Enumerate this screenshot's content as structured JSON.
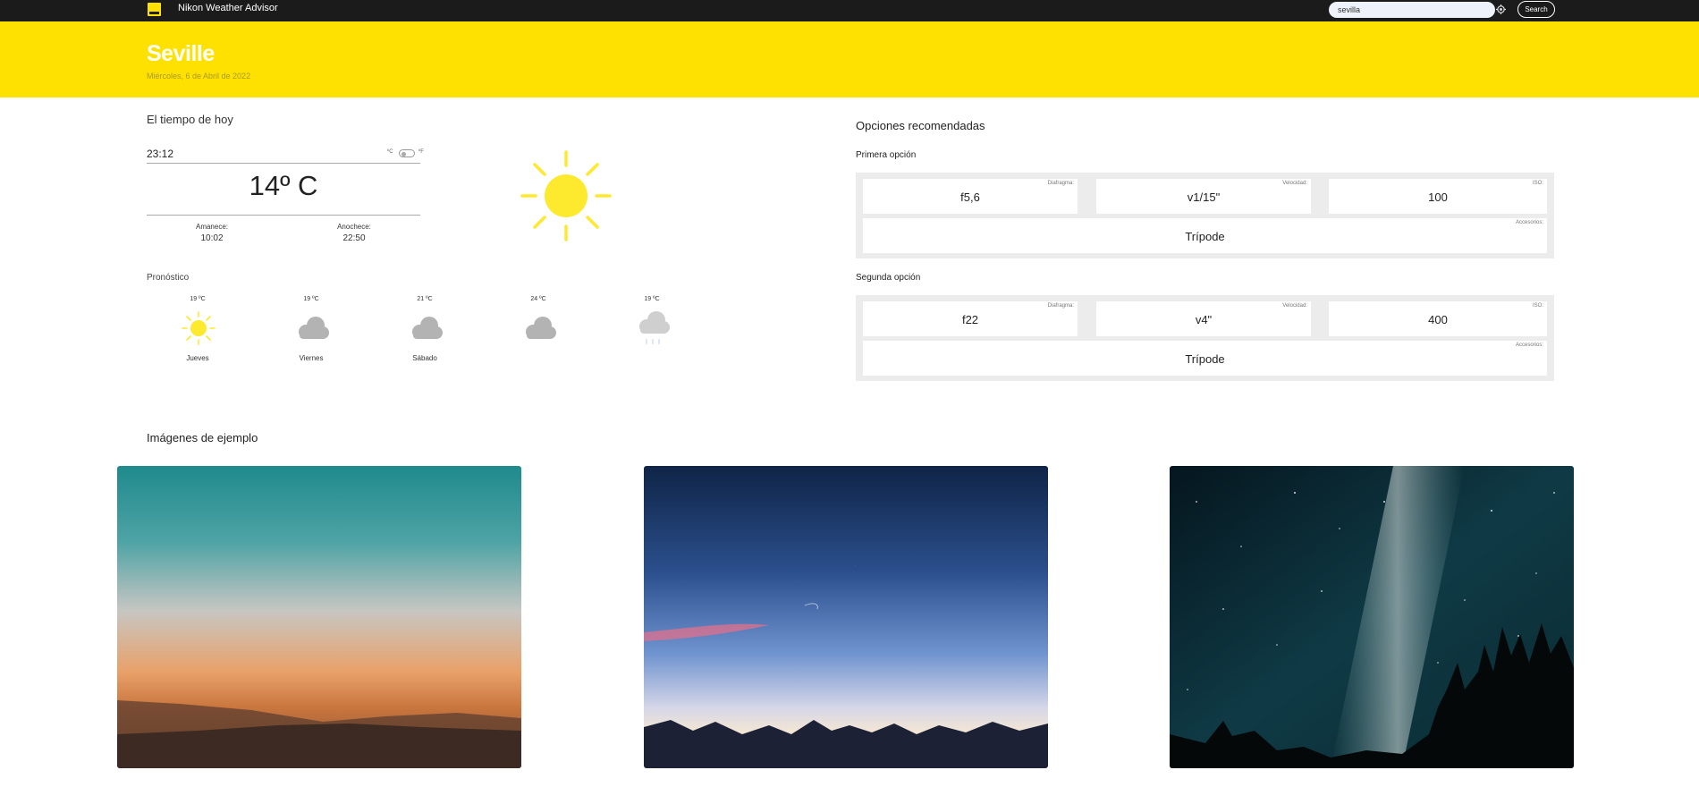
{
  "app": {
    "brand": "Nikon Weather Advisor",
    "logo_icon": "nikon-logo-icon"
  },
  "search": {
    "value": "sevilla",
    "button_label": "Search",
    "locate_icon": "crosshair-icon"
  },
  "hero": {
    "city": "Seville",
    "date": "Miércoles, 6 de Abril de 2022"
  },
  "today": {
    "heading": "El tiempo de hoy",
    "time": "23:12",
    "unit_c": "ºC",
    "unit_f": "ºF",
    "temperature": "14º C",
    "sunrise_label": "Amanece:",
    "sunrise": "10:02",
    "sunset_label": "Anochece:",
    "sunset": "22:50",
    "icon": "sun-icon"
  },
  "forecast": {
    "heading": "Pronóstico",
    "days": [
      {
        "temp": "19 ºC",
        "day": "Jueves",
        "icon": "sun-icon"
      },
      {
        "temp": "19 ºC",
        "day": "Viernes",
        "icon": "cloud-icon"
      },
      {
        "temp": "21 ºC",
        "day": "Sábado",
        "icon": "cloud-icon"
      },
      {
        "temp": "24 ºC",
        "day": "",
        "icon": "cloud-icon"
      },
      {
        "temp": "19 ºC",
        "day": "",
        "icon": "rain-cloud-icon"
      }
    ]
  },
  "options": {
    "heading": "Opciones recomendadas",
    "first": {
      "title": "Primera opción",
      "aperture_label": "Diafragma:",
      "aperture": "f5,6",
      "speed_label": "Velocidad:",
      "speed": "v1/15\"",
      "iso_label": "ISO:",
      "iso": "100",
      "accessories_label": "Accesorios:",
      "accessories": "Trípode"
    },
    "second": {
      "title": "Segunda opción",
      "aperture_label": "Diafragma:",
      "aperture": "f22",
      "speed_label": "Velocidad:",
      "speed": "v4\"",
      "iso_label": "ISO:",
      "iso": "400",
      "accessories_label": "Accesorios:",
      "accessories": "Trípode"
    }
  },
  "examples": {
    "heading": "Imágenes de ejemplo"
  },
  "colors": {
    "brand_yellow": "#ffe100",
    "topbar": "#1b1b1b",
    "panel_gray": "#ececec",
    "sun_yellow": "#fde92d"
  }
}
